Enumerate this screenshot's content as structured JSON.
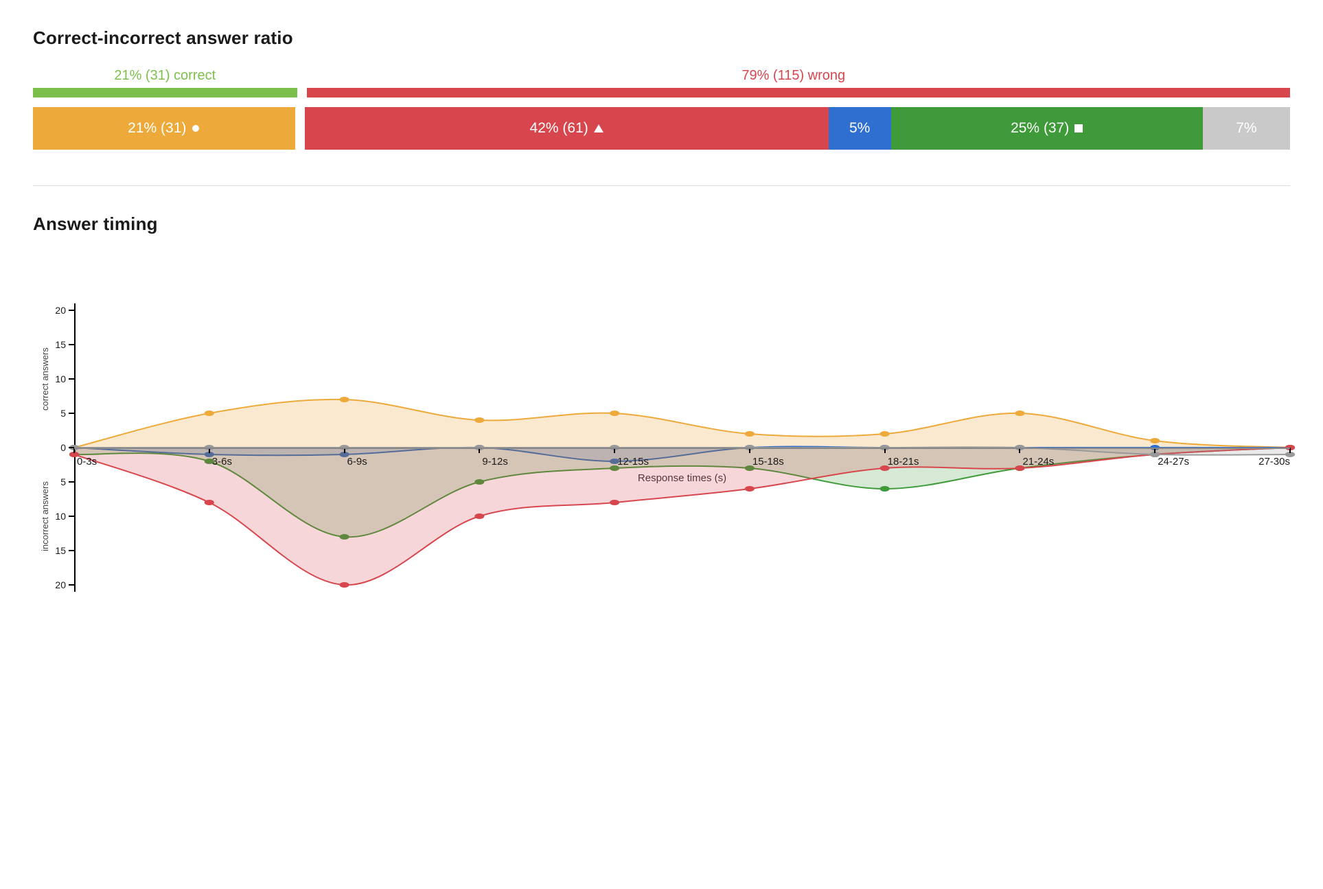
{
  "ratio": {
    "title": "Correct-incorrect answer ratio",
    "correct_label": "21% (31) correct",
    "wrong_label": "79% (115) wrong",
    "correct_pct": 21,
    "wrong_pct": 79,
    "segments": [
      {
        "key": "orange",
        "label": "21% (31)",
        "shape": "circle",
        "pct": 21,
        "color": "#eda93a"
      },
      {
        "key": "red",
        "label": "42% (61)",
        "shape": "triangle",
        "pct": 42,
        "color": "#d7464d"
      },
      {
        "key": "blue",
        "label": "5%",
        "shape": "",
        "pct": 5,
        "color": "#2f6fcf"
      },
      {
        "key": "green",
        "label": "25% (37)",
        "shape": "square",
        "pct": 25,
        "color": "#3f9a3a"
      },
      {
        "key": "gray",
        "label": "7%",
        "shape": "",
        "pct": 7,
        "color": "#c9c9c9"
      }
    ]
  },
  "timing": {
    "title": "Answer timing"
  },
  "chart_data": {
    "type": "area",
    "title": "Answer timing",
    "xlabel": "Response times (s)",
    "ylabel_top": "correct answers",
    "ylabel_bottom": "incorrect answers",
    "categories": [
      "0-3s",
      "3-6s",
      "6-9s",
      "9-12s",
      "12-15s",
      "15-18s",
      "18-21s",
      "21-24s",
      "24-27s",
      "27-30s"
    ],
    "y_ticks_top": [
      0,
      5,
      10,
      15,
      20
    ],
    "y_ticks_bottom": [
      5,
      10,
      15,
      20
    ],
    "ylim_top": [
      0,
      20
    ],
    "ylim_bottom": [
      0,
      20
    ],
    "series": [
      {
        "name": "orange",
        "side": "top",
        "color": "#eda93a",
        "fill": "rgba(237,169,58,0.25)",
        "values": [
          0,
          5,
          7,
          4,
          5,
          2,
          2,
          5,
          1,
          0
        ]
      },
      {
        "name": "blue",
        "side": "bottom",
        "color": "#2f6fcf",
        "fill": "rgba(47,111,207,0.18)",
        "values": [
          0,
          1,
          1,
          0,
          2,
          0,
          0,
          0,
          0,
          0
        ]
      },
      {
        "name": "green",
        "side": "bottom",
        "color": "#3f9a3a",
        "fill": "rgba(63,154,58,0.22)",
        "values": [
          1,
          2,
          13,
          5,
          3,
          3,
          6,
          3,
          1,
          0
        ]
      },
      {
        "name": "red",
        "side": "bottom",
        "color": "#d7464d",
        "fill": "rgba(215,70,77,0.22)",
        "values": [
          1,
          8,
          20,
          10,
          8,
          6,
          3,
          3,
          1,
          0
        ]
      },
      {
        "name": "gray",
        "side": "bottom",
        "color": "#999999",
        "fill": "rgba(150,150,150,0.20)",
        "values": [
          0,
          0,
          0,
          0,
          0,
          0,
          0,
          0,
          1,
          1
        ]
      }
    ]
  }
}
